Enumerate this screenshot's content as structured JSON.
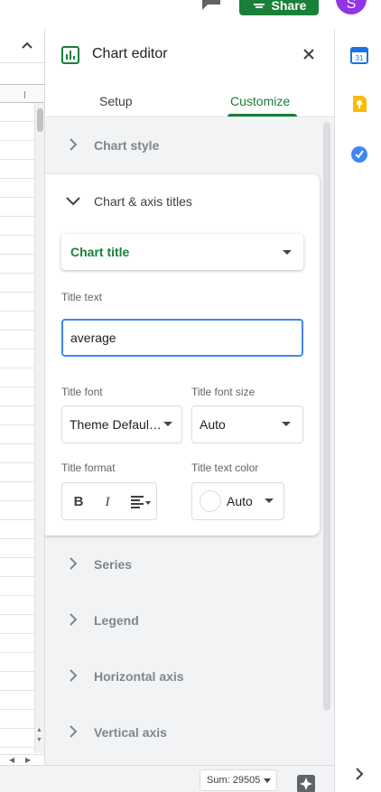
{
  "header": {
    "share_label": "Share",
    "avatar_letter": "S"
  },
  "editor": {
    "title": "Chart editor",
    "tabs": [
      {
        "label": "Setup",
        "active": false
      },
      {
        "label": "Customize",
        "active": true
      }
    ],
    "sections_before": [
      {
        "label": "Chart style"
      }
    ],
    "expanded_section": {
      "label": "Chart & axis titles",
      "title_type": "Chart title",
      "title_text_label": "Title text",
      "title_text_value": "average",
      "title_font_label": "Title font",
      "title_font_value": "Theme Defaul…",
      "title_font_size_label": "Title font size",
      "title_font_size_value": "Auto",
      "title_format_label": "Title format",
      "format_bold": "B",
      "format_italic": "I",
      "title_text_color_label": "Title text color",
      "title_text_color_value": "Auto"
    },
    "sections_after": [
      {
        "label": "Series"
      },
      {
        "label": "Legend"
      },
      {
        "label": "Horizontal axis"
      },
      {
        "label": "Vertical axis"
      }
    ]
  },
  "status_bar": {
    "sum_label": "Sum: 29505"
  },
  "colors": {
    "accent_green": "#188038",
    "focus_blue": "#4285f4",
    "avatar_purple": "#9334e6"
  },
  "side_panel_icons": [
    "calendar-icon",
    "keep-icon",
    "tasks-icon"
  ]
}
